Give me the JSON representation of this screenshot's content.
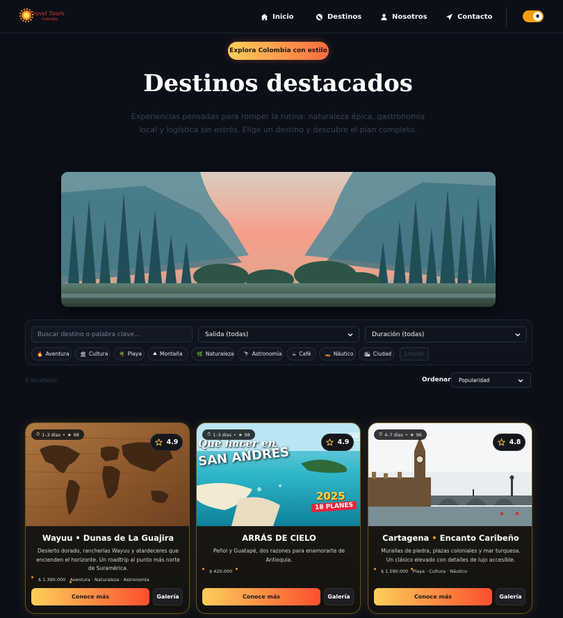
{
  "brand": {
    "logo_text": "Travel Tours",
    "logo_sub": "Colombia"
  },
  "nav": {
    "items": [
      {
        "label": "Inicio",
        "icon": "home-icon"
      },
      {
        "label": "Destinos",
        "icon": "globe-icon"
      },
      {
        "label": "Nosotros",
        "icon": "users-icon"
      },
      {
        "label": "Contacto",
        "icon": "send-icon"
      }
    ],
    "theme_toggle": {
      "state": "on",
      "icon": "sun-icon"
    }
  },
  "hero": {
    "badge": "Explora Colombia con estilo",
    "title": "Destinos destacados",
    "lead": "Experiencias pensadas para romper la rutina: naturaleza épica, gastronomía local y logística sin estrés. Elige un destino y descubre el plan completo."
  },
  "filters": {
    "search_placeholder": "Buscar destino o palabra clave...",
    "departure": "Salida (todas)",
    "duration": "Duración (todas)",
    "chips": [
      {
        "label": "Aventura",
        "icon": "🔥"
      },
      {
        "label": "Cultura",
        "icon": "🏛"
      },
      {
        "label": "Playa",
        "icon": "🌴"
      },
      {
        "label": "Montaña",
        "icon": "⛰"
      },
      {
        "label": "Naturaleza",
        "icon": "🌿"
      },
      {
        "label": "Astronomía",
        "icon": "🔭"
      },
      {
        "label": "Café",
        "icon": "☕"
      },
      {
        "label": "Náutico",
        "icon": "🚤"
      },
      {
        "label": "Ciudad",
        "icon": "🏙"
      }
    ],
    "clear_label": "Limpiar"
  },
  "results": {
    "count_text": "9 resultados",
    "sort_label": "Ordenar:",
    "sort_value": "Popularidad"
  },
  "cards": [
    {
      "duration": "1–3 días",
      "reviews": "98",
      "rating": "4.9",
      "title_a": "Wayuu",
      "title_b": "Dunas de La Guajira",
      "desc": "Desierto dorado, rancherías Wayuu y atardeceres que encienden el horizonte. Un roadtrip al punto más norte de Suramérica.",
      "price": "$ 1.390.000",
      "tags": "Aventura · Naturaleza · Astronomía",
      "cta": "Conoce más",
      "gallery": "Galería"
    },
    {
      "duration": "1–3 días",
      "reviews": "98",
      "rating": "4.9",
      "title_a": "ARRÁS DE CIELO",
      "title_b": "",
      "desc": "Peñol y Guatapé, dos razones para enamorarte de Antioquia.",
      "price": "$ 420.000",
      "tags": "",
      "cta": "Conoce más",
      "gallery": "Galería",
      "image_text": {
        "line1": "Qué hacer en",
        "line2": "SAN ANDRÉS",
        "year": "2025",
        "plans": "18 PLANES",
        "badge": "4K"
      }
    },
    {
      "duration": "4–7 días",
      "reviews": "96",
      "rating": "4.8",
      "title_a": "Cartagena",
      "title_b": "Encanto Caribeño",
      "desc": "Murallas de piedra, plazas coloniales y mar turquesa. Un clásico elevado con detalles de lujo accesible.",
      "price": "$ 1.590.000",
      "tags": "Playa · Cultura · Náutico",
      "cta": "Conoce más",
      "gallery": "Galería"
    }
  ],
  "colors": {
    "accent_start": "#fdcf5a",
    "accent_end": "#fb4f2e",
    "bg": "#0b0f18",
    "gold": "#f59e0b"
  }
}
